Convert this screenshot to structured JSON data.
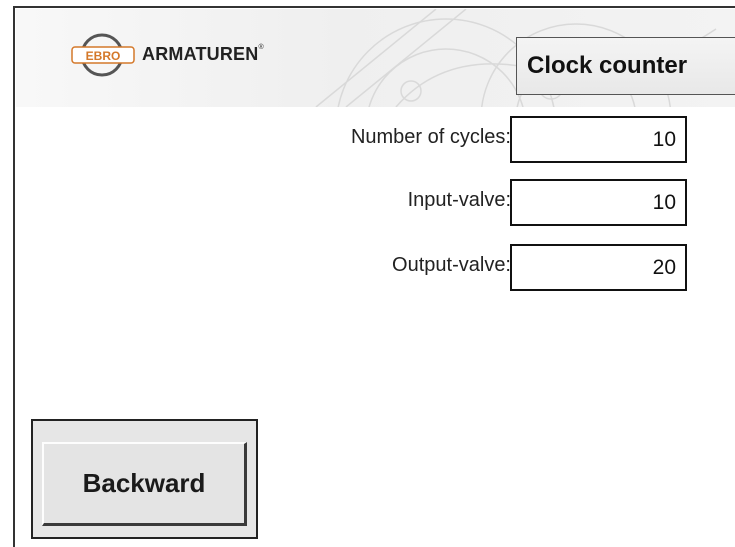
{
  "header": {
    "logo_text": "ARMATUREN",
    "logo_trademark": "®",
    "logo_emblem_text": "EBRO",
    "title": "Clock counter"
  },
  "fields": [
    {
      "label": "Number of cycles:",
      "value": "10"
    },
    {
      "label": "Input-valve:",
      "value": "10"
    },
    {
      "label": "Output-valve:",
      "value": "20"
    }
  ],
  "buttons": {
    "backward_label": "Backward"
  },
  "colors": {
    "logo_accent": "#d4782a",
    "title_box_bg": "#ececec",
    "button_face": "#e4e4e4"
  }
}
